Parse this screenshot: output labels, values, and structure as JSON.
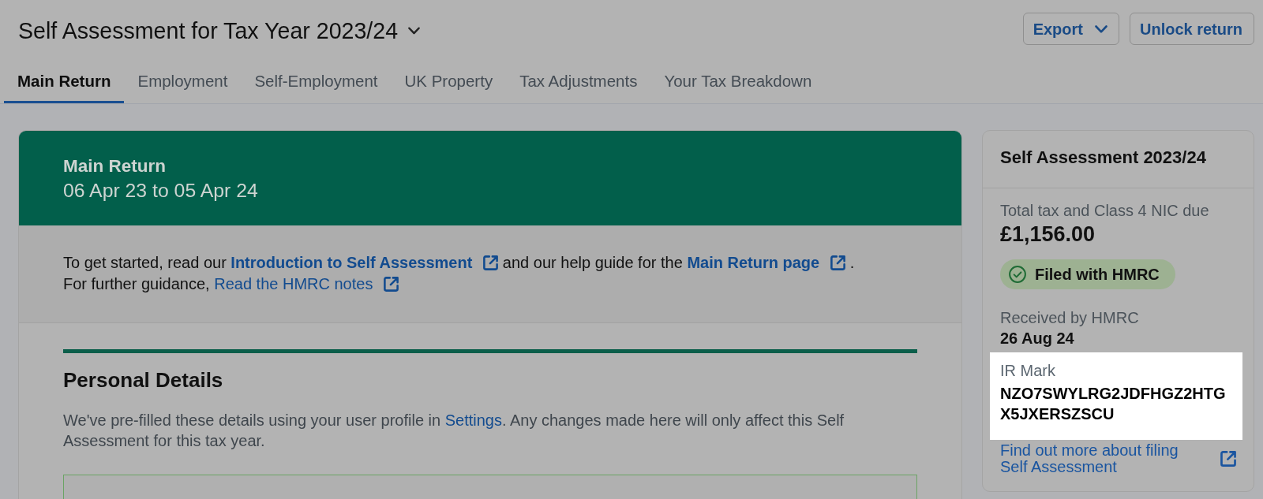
{
  "header": {
    "title": {
      "text": "Self Assessment for Tax Year 2023/24",
      "dropdown": true
    },
    "buttons": [
      {
        "label": "Export",
        "kind": "dropdown"
      },
      {
        "label": "Unlock return",
        "kind": "plain"
      }
    ]
  },
  "tabs": [
    {
      "label": "Main Return",
      "selected": true
    },
    {
      "label": "Employment",
      "selected": false
    },
    {
      "label": "Self-Employment",
      "selected": false
    },
    {
      "label": "UK Property",
      "selected": false
    },
    {
      "label": "Tax Adjustments",
      "selected": false
    },
    {
      "label": "Your Tax Breakdown",
      "selected": false
    }
  ],
  "main_card": {
    "title": "Main Return",
    "period": "06 Apr 23 to 05 Apr 24",
    "intro": [
      [
        {
          "kind": "text",
          "text": "To get started, read our "
        },
        {
          "kind": "link",
          "text": "Introduction to Self Assessment",
          "bold": true,
          "external": true
        },
        {
          "kind": "text",
          "text": " and our help guide for the "
        },
        {
          "kind": "link",
          "text": "Main Return page",
          "bold": true,
          "external": true
        },
        {
          "kind": "text",
          "text": " ."
        }
      ],
      [
        {
          "kind": "text",
          "text": "For further guidance, "
        },
        {
          "kind": "link",
          "text": "Read the HMRC notes",
          "bold": false,
          "external": true
        }
      ]
    ],
    "section": {
      "title": "Personal Details",
      "description": [
        {
          "kind": "text",
          "text": "We've pre-filled these details using your user profile in "
        },
        {
          "kind": "link",
          "text": "Settings",
          "bold": false,
          "external": false
        },
        {
          "kind": "text",
          "text": ". Any changes made here will only affect this Self Assessment for this tax year."
        }
      ]
    }
  },
  "summary": {
    "title": "Self Assessment 2023/24",
    "total_label": "Total tax and Class 4 NIC due",
    "total": "£1,156.00",
    "status": {
      "label": "Filed with HMRC",
      "kind": "filed"
    },
    "received_label": "Received by HMRC",
    "received": "26 Aug 24",
    "ir_mark": {
      "label": "IR Mark",
      "value": "NZO7SWYLRG2JDFHGZ2HTGX5JXERSZSCU",
      "highlighted": true
    },
    "link": {
      "text": "Find out more about filing Self Assessment",
      "external": true
    }
  }
}
